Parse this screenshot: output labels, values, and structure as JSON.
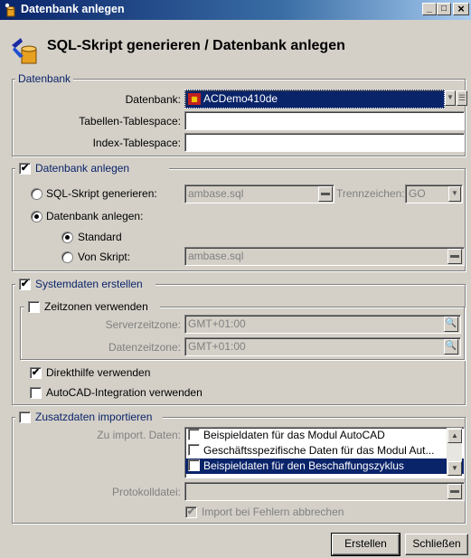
{
  "window": {
    "title": "Datenbank anlegen",
    "min": "_",
    "max": "□",
    "close": "×"
  },
  "header": {
    "title": "SQL-Skript generieren / Datenbank anlegen"
  },
  "datenbank_group": {
    "title": "Datenbank",
    "db_label": "Datenbank:",
    "db_value": "ACDemo410de",
    "table_ts_label": "Tabellen-Tablespace:",
    "table_ts_value": "",
    "index_ts_label": "Index-Tablespace:",
    "index_ts_value": ""
  },
  "anlegen_group": {
    "title": "Datenbank anlegen",
    "checked": true,
    "sql_radio_label": "SQL-Skript generieren:",
    "sql_file": "ambase.sql",
    "separator_label": "Trennzeichen:",
    "separator_value": "GO",
    "create_radio_label": "Datenbank anlegen:",
    "standard_label": "Standard",
    "script_label": "Von Skript:",
    "script_file": "ambase.sql"
  },
  "system_group": {
    "title": "Systemdaten erstellen",
    "checked": true,
    "tz_title": "Zeitzonen verwenden",
    "server_tz_label": "Serverzeitzone:",
    "server_tz_value": "GMT+01:00",
    "db_tz_label": "Datenzeitzone:",
    "db_tz_value": "GMT+01:00",
    "help_label": "Direkthilfe verwenden",
    "autocad_label": "AutoCAD-Integration verwenden"
  },
  "import_group": {
    "title": "Zusatzdaten importieren",
    "list_label": "Zu import. Daten:",
    "items": [
      "Beispieldaten für das Modul AutoCAD",
      "Geschäftsspezifische Daten für das Modul Aut...",
      "Beispieldaten für den Beschaffungszyklus"
    ],
    "log_label": "Protokolldatei:",
    "log_value": "",
    "abort_label": "Import bei Fehlern abbrechen"
  },
  "buttons": {
    "create": "Erstellen",
    "close": "Schließen"
  }
}
